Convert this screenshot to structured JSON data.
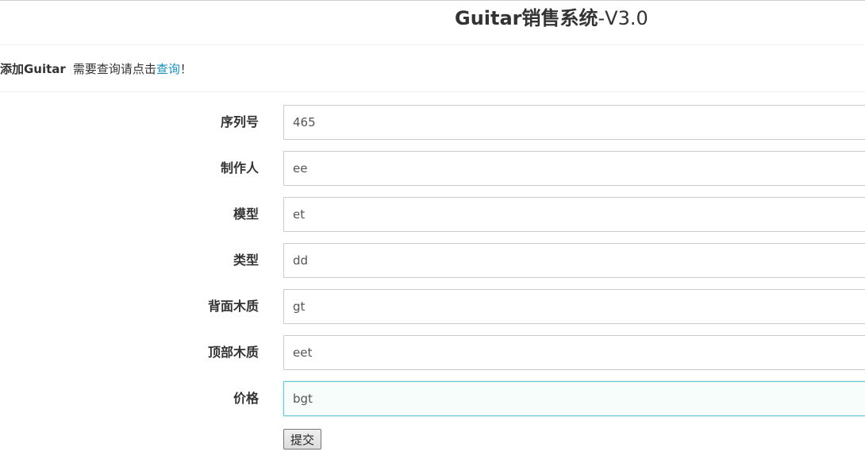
{
  "header": {
    "title_main": "Guitar销售系统",
    "title_version": "-V3.0"
  },
  "subheader": {
    "section_title": "添加Guitar",
    "hint_prefix": "需要查询请点击",
    "query_link": "查询",
    "hint_suffix": "！"
  },
  "form": {
    "fields": [
      {
        "label": "序列号",
        "value": "465"
      },
      {
        "label": "制作人",
        "value": "ee"
      },
      {
        "label": "模型",
        "value": "et"
      },
      {
        "label": "类型",
        "value": "dd"
      },
      {
        "label": "背面木质",
        "value": "gt"
      },
      {
        "label": "顶部木质",
        "value": "eet"
      },
      {
        "label": "价格",
        "value": "bgt"
      }
    ],
    "submit_label": "提交"
  },
  "colors": {
    "link": "#1a8fb5",
    "focus_border": "#66c6d4",
    "text": "#333333"
  }
}
